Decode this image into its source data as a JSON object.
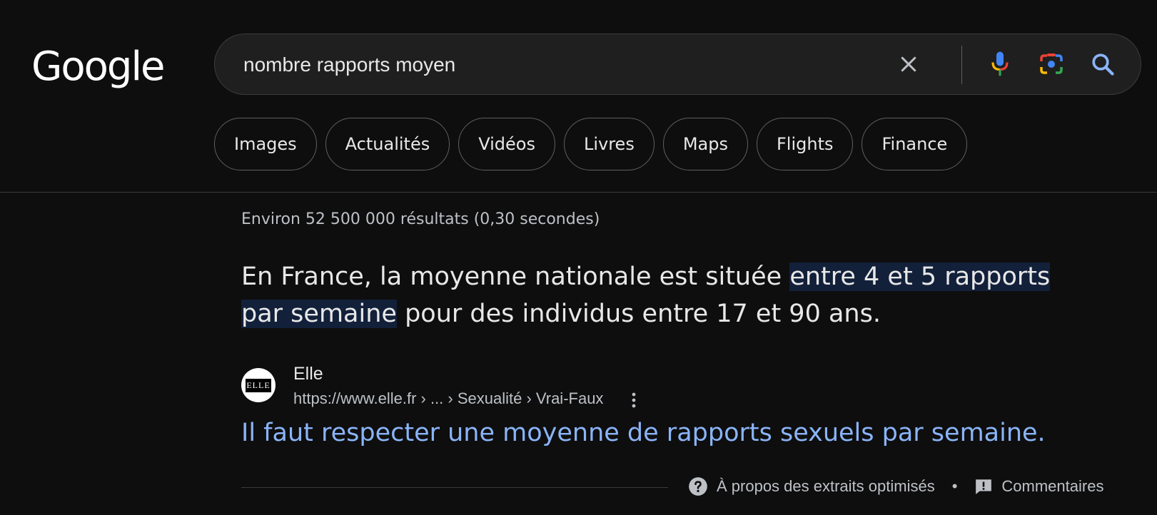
{
  "logo": {
    "text": "Google"
  },
  "search": {
    "query": "nombre rapports moyen"
  },
  "icons": {
    "clear": "close-icon",
    "voice": "microphone-icon",
    "lens": "camera-icon",
    "search": "search-icon"
  },
  "chips": [
    {
      "label": "Images"
    },
    {
      "label": "Actualités"
    },
    {
      "label": "Vidéos"
    },
    {
      "label": "Livres"
    },
    {
      "label": "Maps"
    },
    {
      "label": "Flights"
    },
    {
      "label": "Finance"
    }
  ],
  "results": {
    "stats": "Environ 52 500 000 résultats (0,30 secondes)",
    "snippet": {
      "before": "En France, la moyenne nationale est située ",
      "highlight": "entre 4 et 5 rapports par semaine",
      "after": " pour des individus entre 17 et 90 ans."
    },
    "source": {
      "favicon_text": "ELLE",
      "name": "Elle",
      "url": "https://www.elle.fr › ... › Sexualité › Vrai-Faux"
    },
    "title": "Il faut respecter une moyenne de rapports sexuels par semaine."
  },
  "footer": {
    "about": "À propos des extraits optimisés",
    "separator": "•",
    "feedback": "Commentaires"
  },
  "colors": {
    "background": "#0e0e0e",
    "link": "#8ab4f8",
    "highlight": "#12203a"
  }
}
